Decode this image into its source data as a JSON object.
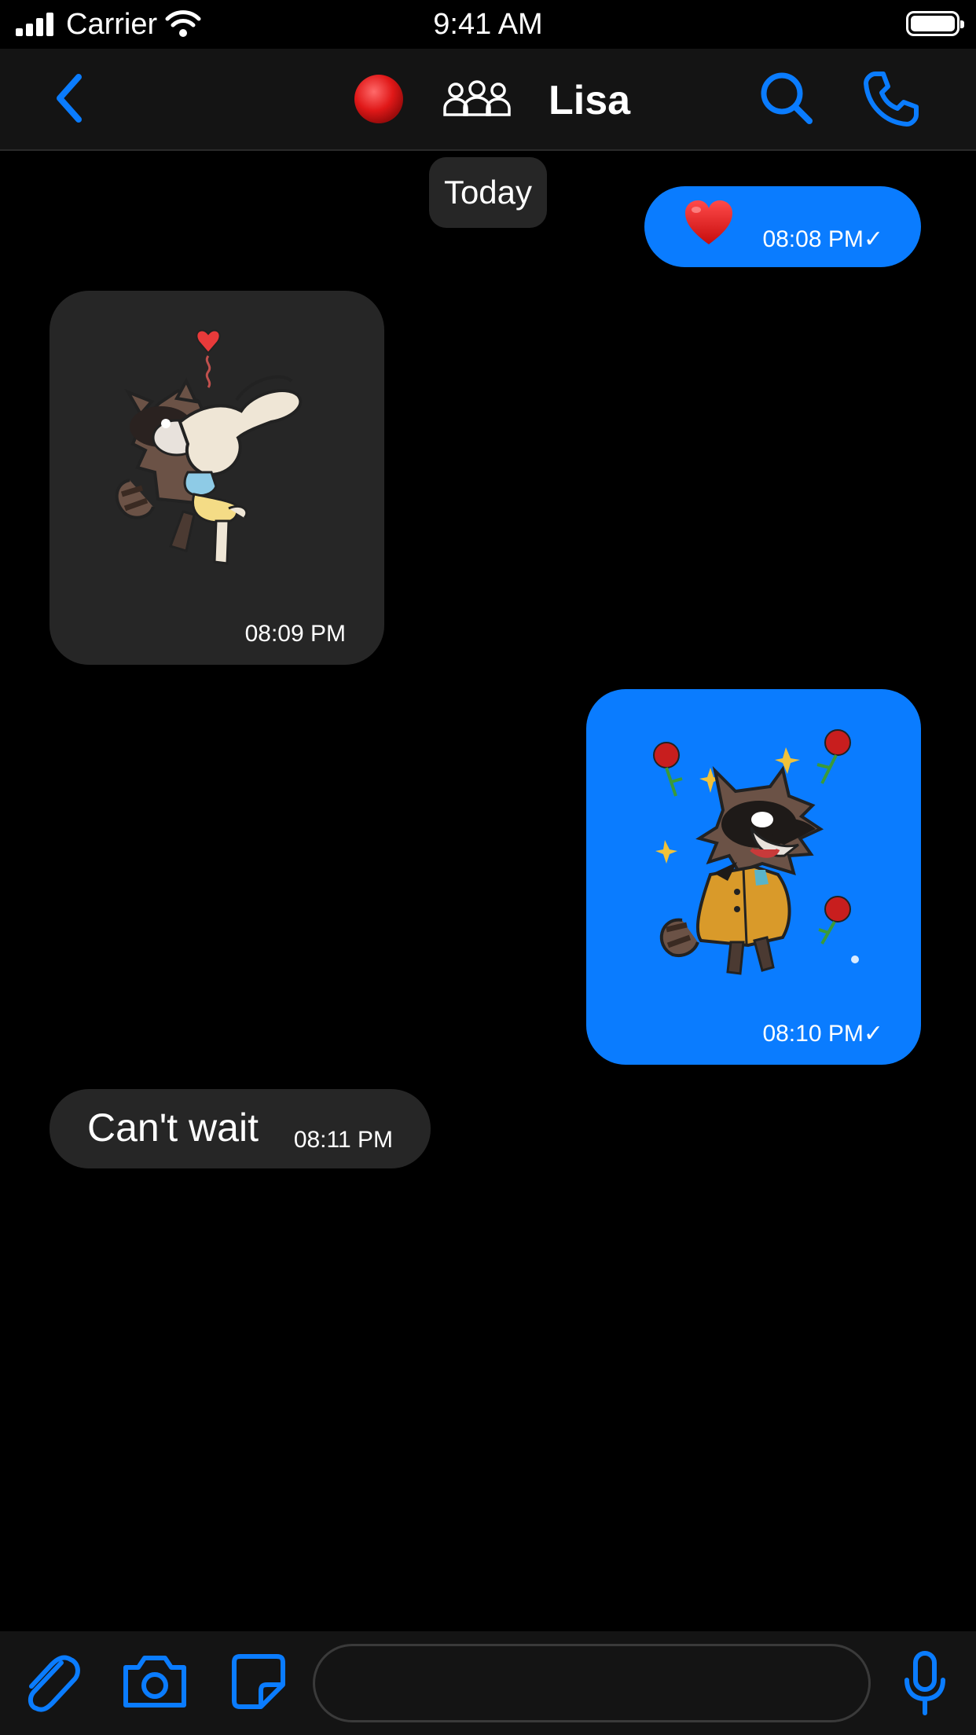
{
  "status_bar": {
    "carrier": "Carrier",
    "time": "9:41 AM"
  },
  "header": {
    "title": "Lisa",
    "icons": [
      "back-chevron-icon",
      "red-dot-icon",
      "group-icon",
      "search-icon",
      "phone-icon"
    ]
  },
  "date_separator": "Today",
  "messages": [
    {
      "direction": "outgoing",
      "type": "emoji",
      "content": "❤️",
      "time": "08:08 PM",
      "status": "✓"
    },
    {
      "direction": "incoming",
      "type": "sticker",
      "sticker": "raccoon-hugging-bunny-sticker",
      "time": "08:09 PM"
    },
    {
      "direction": "outgoing",
      "type": "sticker",
      "sticker": "raccoon-with-roses-sticker",
      "time": "08:10 PM",
      "status": "✓"
    },
    {
      "direction": "incoming",
      "type": "text",
      "text": "Can't wait",
      "time": "08:11 PM"
    }
  ],
  "composer": {
    "placeholder": "",
    "icons": [
      "paperclip-icon",
      "camera-icon",
      "sticker-icon",
      "microphone-icon"
    ]
  },
  "colors": {
    "accent": "#0a7cff",
    "incoming_bubble": "#262626",
    "bar_bg": "#141414",
    "background": "#000000"
  }
}
